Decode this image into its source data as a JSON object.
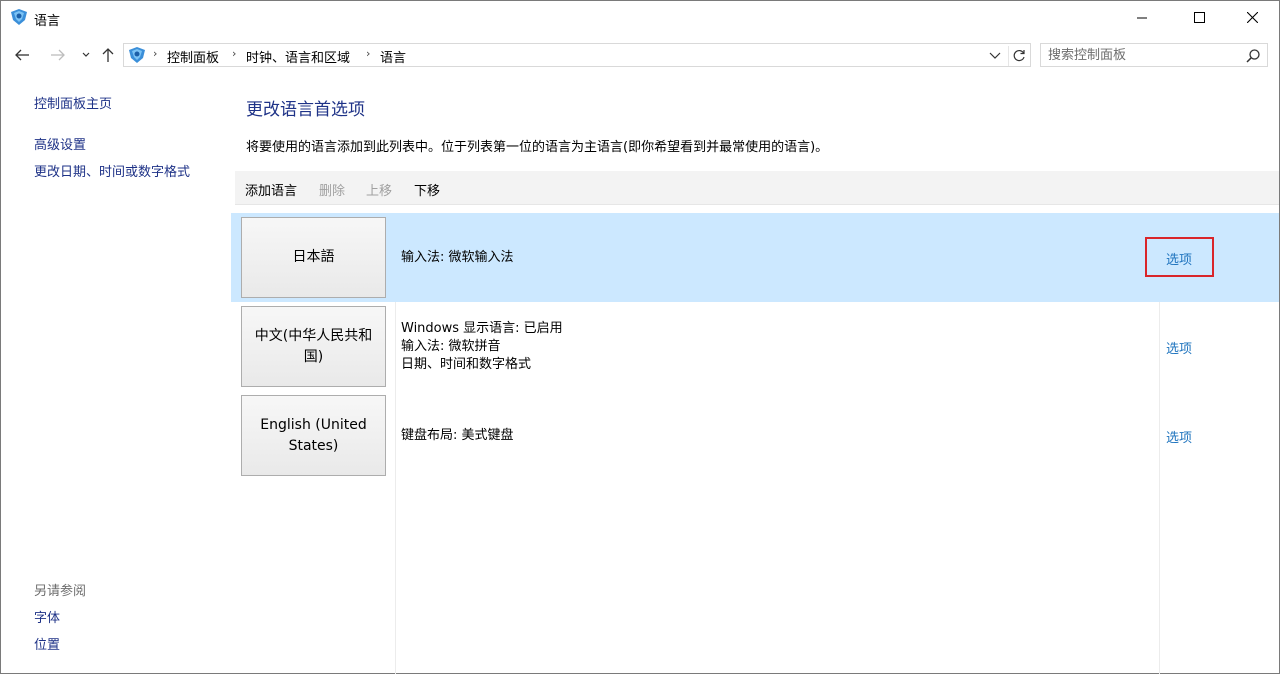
{
  "window": {
    "title": "语言"
  },
  "address_bar": {
    "breadcrumbs": [
      "控制面板",
      "时钟、语言和区域",
      "语言"
    ],
    "separator": "›"
  },
  "search": {
    "placeholder": "搜索控制面板"
  },
  "left_pane": {
    "home_link": "控制面板主页",
    "links": [
      "高级设置",
      "更改日期、时间或数字格式"
    ],
    "see_also_label": "另请参阅",
    "see_also_links": [
      "字体",
      "位置"
    ]
  },
  "main": {
    "title": "更改语言首选项",
    "description": "将要使用的语言添加到此列表中。位于列表第一位的语言为主语言(即你希望看到并最常使用的语言)。",
    "toolbar": {
      "add": "添加语言",
      "remove": "删除",
      "move_up": "上移",
      "move_down": "下移"
    },
    "languages": [
      {
        "name": "日本語",
        "details": [
          "输入法: 微软输入法"
        ],
        "options_label": "选项",
        "selected": true,
        "highlighted": true
      },
      {
        "name": "中文(中华人民共和国)",
        "details": [
          "Windows 显示语言: 已启用",
          "输入法: 微软拼音",
          "日期、时间和数字格式"
        ],
        "options_label": "选项",
        "selected": false
      },
      {
        "name": "English (United States)",
        "details": [
          "键盘布局: 美式键盘"
        ],
        "options_label": "选项",
        "selected": false
      }
    ]
  },
  "colors": {
    "link": "#1e3287",
    "option_link": "#1e73be",
    "selected_row": "#cce8ff",
    "highlight_border": "#d9252a"
  },
  "icons": {
    "app": "control-panel-icon",
    "back": "arrow-left-icon",
    "forward": "arrow-right-icon",
    "recent": "chevron-down-icon",
    "up": "arrow-up-icon",
    "refresh": "refresh-icon",
    "search": "search-icon"
  }
}
